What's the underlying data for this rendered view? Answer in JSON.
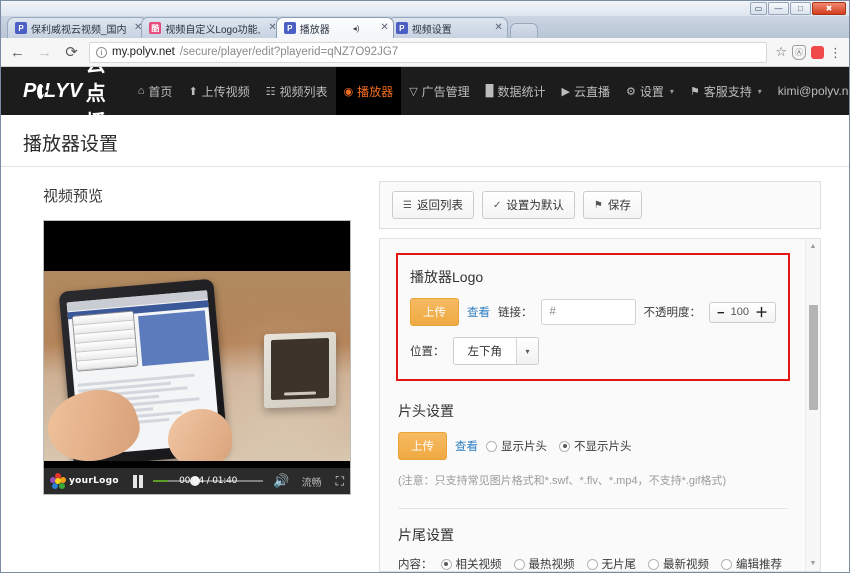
{
  "window": {
    "controls": {
      "lock": "▭",
      "minimize": "—",
      "maximize": "□",
      "close": "✖"
    }
  },
  "browser": {
    "tabs": [
      {
        "favicon": "P",
        "label": "保利威视云视频_国内技",
        "close": "✕",
        "active": false,
        "muted": false
      },
      {
        "favicon": "酷",
        "label": "视频自定义Logo功能,保",
        "close": "✕",
        "active": false,
        "muted": false
      },
      {
        "favicon": "P",
        "label": "播放器",
        "close": "✕",
        "active": true,
        "muted": true,
        "mute_icon": "◂)"
      },
      {
        "favicon": "P",
        "label": "视频设置",
        "close": "✕",
        "active": false,
        "muted": false
      }
    ],
    "toolbar": {
      "back_icon": "←",
      "forward_icon": "→",
      "reload_icon": "⟳",
      "info_icon": "i",
      "url_host": "my.polyv.net",
      "url_path": "/secure/player/edit?playerid=qNZ7O92JG7",
      "star_icon": "☆",
      "shield_icon": "Ⓐ",
      "extension_icon": "red-square",
      "menu_icon": "⋮"
    }
  },
  "site": {
    "brand": {
      "pre": "P",
      "circle": "O",
      "post": "LYV",
      "cn": "云点播"
    },
    "nav": [
      {
        "icon": "⌂",
        "label": "首页",
        "active": false,
        "caret": false
      },
      {
        "icon": "⬆",
        "label": "上传视频",
        "active": false,
        "caret": false
      },
      {
        "icon": "☷",
        "label": "视频列表",
        "active": false,
        "caret": false
      },
      {
        "icon": "◉",
        "label": "播放器",
        "active": true,
        "caret": false
      },
      {
        "icon": "▽",
        "label": "广告管理",
        "active": false,
        "caret": false
      },
      {
        "icon": "█",
        "label": "数据统计",
        "active": false,
        "caret": false
      },
      {
        "icon": "▶",
        "label": "云直播",
        "active": false,
        "caret": false
      },
      {
        "icon": "⚙",
        "label": "设置",
        "active": false,
        "caret": true
      },
      {
        "icon": "⚑",
        "label": "客服支持",
        "active": false,
        "caret": true
      },
      {
        "icon": "",
        "label": "kimi@polyv.net",
        "active": false,
        "caret": true,
        "blurred": true
      }
    ]
  },
  "page": {
    "title": "播放器设置",
    "preview": {
      "heading": "视频预览",
      "player": {
        "logo_text": "yourLogo",
        "pause_icon": "pause",
        "current_time": "00:04",
        "separator": "/",
        "total_time": "01:40",
        "volume_icon": "🔊",
        "quality": "流畅",
        "fullscreen_icon": "fullscreen"
      }
    },
    "actions": [
      {
        "icon": "☰",
        "label": "返回列表"
      },
      {
        "icon": "✓",
        "label": "设置为默认"
      },
      {
        "icon": "⚑",
        "label": "保存"
      }
    ],
    "sections": {
      "logo": {
        "heading": "播放器Logo",
        "upload_label": "上传",
        "view_label": "查看",
        "link_label": "链接：",
        "link_value": "#",
        "opacity_label": "不透明度：",
        "opacity_minus": "−",
        "opacity_value": "100",
        "opacity_plus": "＋",
        "position_label": "位置：",
        "position_value": "左下角",
        "position_caret": "▾"
      },
      "intro": {
        "heading": "片头设置",
        "upload_label": "上传",
        "view_label": "查看",
        "options": [
          {
            "label": "显示片头",
            "selected": false
          },
          {
            "label": "不显示片头",
            "selected": true
          }
        ],
        "note": "(注意：只支持常见图片格式和*.swf、*.flv、*.mp4，不支持*.gif格式)"
      },
      "outro": {
        "heading": "片尾设置",
        "content_label": "内容：",
        "options": [
          {
            "label": "相关视频",
            "selected": true
          },
          {
            "label": "最热视频",
            "selected": false
          },
          {
            "label": "无片尾",
            "selected": false
          },
          {
            "label": "最新视频",
            "selected": false
          },
          {
            "label": "编辑推荐",
            "selected": false
          }
        ]
      }
    },
    "scrollbar": {
      "up": "▲",
      "down": "▼"
    }
  },
  "colors": {
    "accent_orange": "#f26c1f",
    "upload_orange": "#efa941",
    "highlight_red": "#e61515",
    "link_blue": "#2e7fc4",
    "nav_black": "#1c1c1c"
  }
}
